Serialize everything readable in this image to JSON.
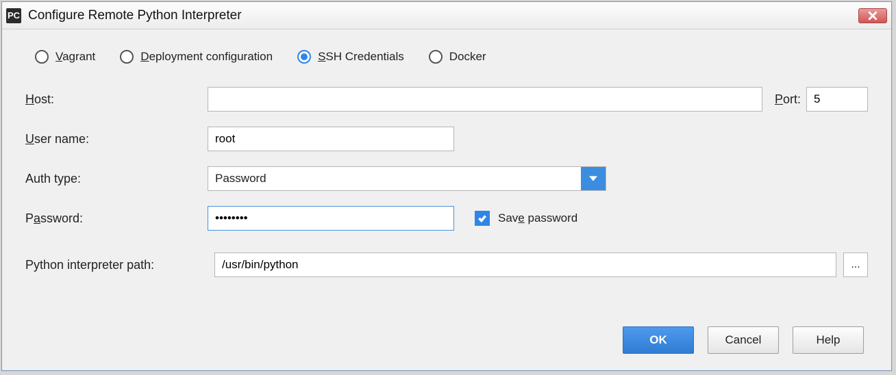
{
  "titlebar": {
    "title": "Configure Remote Python Interpreter"
  },
  "radios": {
    "vagrant_u": "V",
    "vagrant_rest": "agrant",
    "deploy_u": "D",
    "deploy_rest": "eployment configuration",
    "ssh_u": "S",
    "ssh_rest": "SH Credentials",
    "docker": "Docker",
    "selected": "ssh"
  },
  "labels": {
    "host_u": "H",
    "host_rest": "ost:",
    "port_u": "P",
    "port_rest": "ort:",
    "user_u": "U",
    "user_rest": "ser name:",
    "auth": "Auth type:",
    "pw_pre": "P",
    "pw_u": "a",
    "pw_rest": "ssword:",
    "save_pre": "Sav",
    "save_u": "e",
    "save_rest": " password",
    "path": "Python interpreter path:"
  },
  "fields": {
    "host": "",
    "port": "5",
    "user": "root",
    "auth_type": "Password",
    "password": "••••••••",
    "save_password": true,
    "path": "/usr/bin/python"
  },
  "buttons": {
    "ok": "OK",
    "cancel": "Cancel",
    "help": "Help",
    "browse": "..."
  }
}
